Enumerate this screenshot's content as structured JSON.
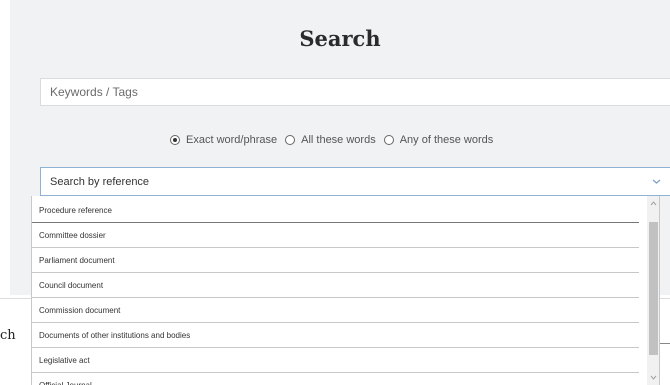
{
  "search": {
    "title": "Search",
    "keywords_placeholder": "Keywords / Tags",
    "keywords_value": "",
    "match_options": [
      {
        "label": "Exact word/phrase",
        "checked": true
      },
      {
        "label": "All these words",
        "checked": false
      },
      {
        "label": "Any of these words",
        "checked": false
      }
    ],
    "reference_select": {
      "value": "Search by reference",
      "icon": "chevron-down-icon",
      "expanded": true
    },
    "reference_options": [
      "Procedure reference",
      "Committee dossier",
      "Parliament document",
      "Council document",
      "Commission document",
      "Documents of other institutions and bodies",
      "Legislative act",
      "Official Journal"
    ]
  },
  "background": {
    "partial_heading": "ch"
  },
  "colors": {
    "panel_bg": "#f1f2f4",
    "select_border": "#8fb1d6",
    "scroll_thumb": "#c1c1c1"
  }
}
